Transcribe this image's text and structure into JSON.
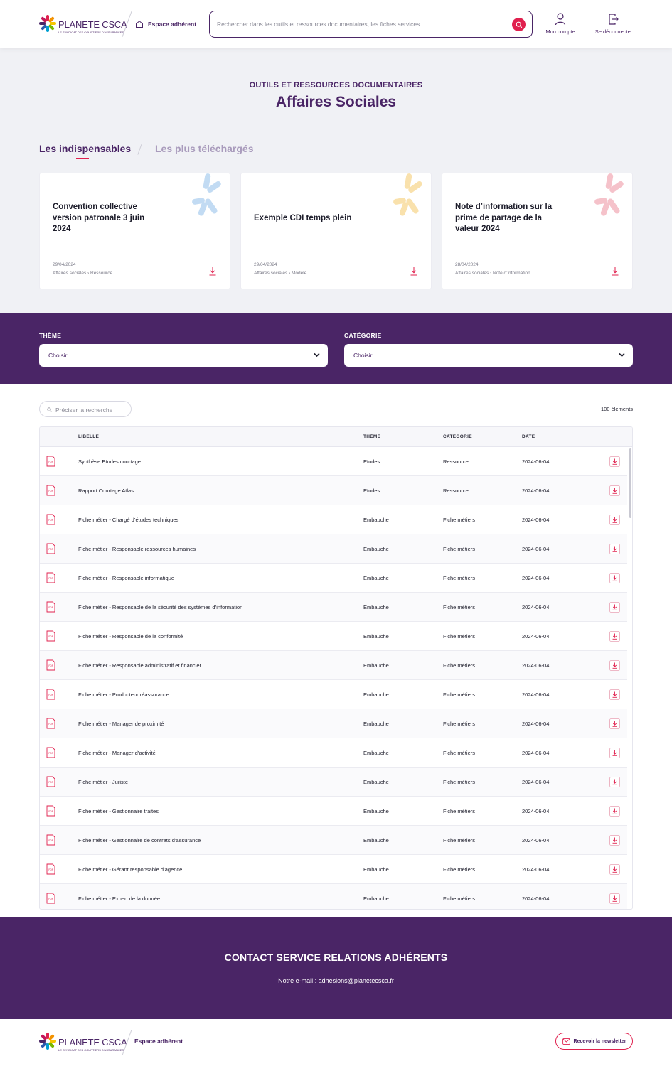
{
  "header": {
    "logo_text": "PLANETE CSCA",
    "logo_subtitle": "LE SYNDICAT DES COURTIERS D'ASSURANCES",
    "espace_label": "Espace adhérent",
    "search_placeholder": "Rechercher dans les outils et ressources documentaires, les fiches services",
    "account_label": "Mon compte",
    "logout_label": "Se déconnecter"
  },
  "hero": {
    "kicker": "OUTILS ET RESSOURCES DOCUMENTAIRES",
    "title": "Affaires Sociales"
  },
  "tabs": [
    {
      "label": "Les indispensables",
      "active": true
    },
    {
      "label": "Les plus téléchargés",
      "active": false
    }
  ],
  "cards": [
    {
      "title": "Convention collective version patronale 3 juin 2024",
      "date": "29/04/2024",
      "theme": "Affaires sociales",
      "category": "Ressource",
      "deco_color": "#a9cdee"
    },
    {
      "title": "Exemple CDI temps plein",
      "date": "29/04/2024",
      "theme": "Affaires sociales",
      "category": "Modèle",
      "deco_color": "#f7d58a"
    },
    {
      "title": "Note d’information sur la prime de partage de la valeur 2024",
      "date": "28/04/2024",
      "theme": "Affaires sociales",
      "category": "Note d’information",
      "deco_color": "#f2a9b4"
    }
  ],
  "filters": {
    "theme_label": "THÈME",
    "theme_value": "Choisir",
    "category_label": "CATÉGORIE",
    "category_value": "Choisir"
  },
  "list": {
    "refine_placeholder": "Préciser la recherche",
    "count_text": "100 éléments",
    "columns": [
      "LIBELLÉ",
      "THÈME",
      "CATÉGORIE",
      "DATE"
    ],
    "pdf_badge": "PDF",
    "rows": [
      {
        "label": "Synthèse Etudes courtage",
        "theme": "Etudes",
        "category": "Ressource",
        "date": "2024-06-04"
      },
      {
        "label": "Rapport Courtage Atlas",
        "theme": "Etudes",
        "category": "Ressource",
        "date": "2024-06-04"
      },
      {
        "label": "Fiche métier - Chargé d’études techniques",
        "theme": "Embauche",
        "category": "Fiche métiers",
        "date": "2024-06-04"
      },
      {
        "label": "Fiche métier - Responsable ressources humaines",
        "theme": "Embauche",
        "category": "Fiche métiers",
        "date": "2024-06-04"
      },
      {
        "label": "Fiche métier - Responsable informatique",
        "theme": "Embauche",
        "category": "Fiche métiers",
        "date": "2024-06-04"
      },
      {
        "label": "Fiche métier - Responsable de la sécurité des systèmes d’information",
        "theme": "Embauche",
        "category": "Fiche métiers",
        "date": "2024-06-04"
      },
      {
        "label": "Fiche métier - Responsable de la conformité",
        "theme": "Embauche",
        "category": "Fiche métiers",
        "date": "2024-06-04"
      },
      {
        "label": "Fiche métier - Responsable administratif et financier",
        "theme": "Embauche",
        "category": "Fiche métiers",
        "date": "2024-06-04"
      },
      {
        "label": "Fiche métier - Producteur réassurance",
        "theme": "Embauche",
        "category": "Fiche métiers",
        "date": "2024-06-04"
      },
      {
        "label": "Fiche métier - Manager de proximité",
        "theme": "Embauche",
        "category": "Fiche métiers",
        "date": "2024-06-04"
      },
      {
        "label": "Fiche métier - Manager d’activité",
        "theme": "Embauche",
        "category": "Fiche métiers",
        "date": "2024-06-04"
      },
      {
        "label": "Fiche métier - Juriste",
        "theme": "Embauche",
        "category": "Fiche métiers",
        "date": "2024-06-04"
      },
      {
        "label": "Fiche métier - Gestionnaire traites",
        "theme": "Embauche",
        "category": "Fiche métiers",
        "date": "2024-06-04"
      },
      {
        "label": "Fiche métier - Gestionnaire de contrats d’assurance",
        "theme": "Embauche",
        "category": "Fiche métiers",
        "date": "2024-06-04"
      },
      {
        "label": "Fiche métier - Gérant responsable d’agence",
        "theme": "Embauche",
        "category": "Fiche métiers",
        "date": "2024-06-04"
      },
      {
        "label": "Fiche métier - Expert de la donnée",
        "theme": "Embauche",
        "category": "Fiche métiers",
        "date": "2024-06-04"
      }
    ]
  },
  "contact": {
    "title": "CONTACT SERVICE RELATIONS ADHÉRENTS",
    "email_line": "Notre e-mail : adhesions@planetecsca.fr"
  },
  "footer": {
    "espace_label": "Espace adhérent",
    "newsletter_label": "Recevoir la newsletter"
  },
  "colors": {
    "brand_purple": "#4a2566",
    "accent_pink": "#e0204e"
  }
}
